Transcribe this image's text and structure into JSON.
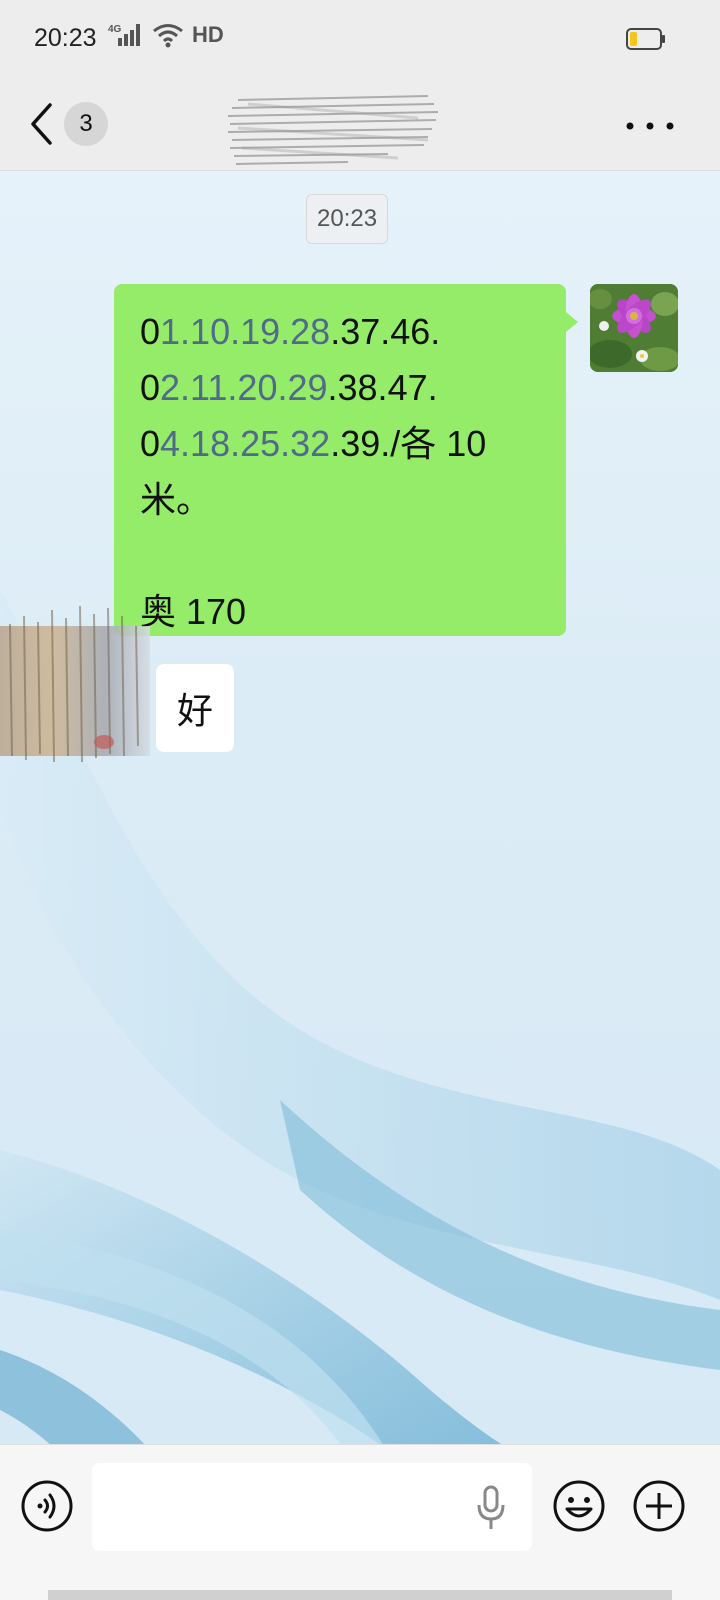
{
  "status_bar": {
    "time": "20:23",
    "network": "4G",
    "hd_label": "HD",
    "battery_color": "#f5c518"
  },
  "header": {
    "unread_count": "3",
    "title_redacted": true
  },
  "chat": {
    "timestamp": "20:23",
    "sent_message": {
      "line1_prefix": "0",
      "line1_link": "1.10.19.28",
      "line1_suffix": ".37.46.",
      "line2_prefix": "0",
      "line2_link": "2.11.20.29",
      "line2_suffix": ".38.47.",
      "line3_prefix": "0",
      "line3_link": "4.18.25.32",
      "line3_suffix": ".39./各 10",
      "line4": "米。",
      "line6": "奥 170"
    },
    "received_message": {
      "text": "好"
    }
  },
  "input_bar": {
    "placeholder": ""
  },
  "colors": {
    "sent_bubble": "#95ec69",
    "received_bubble": "#ffffff",
    "link_text": "#506a8c",
    "bar_background": "#ededed"
  }
}
